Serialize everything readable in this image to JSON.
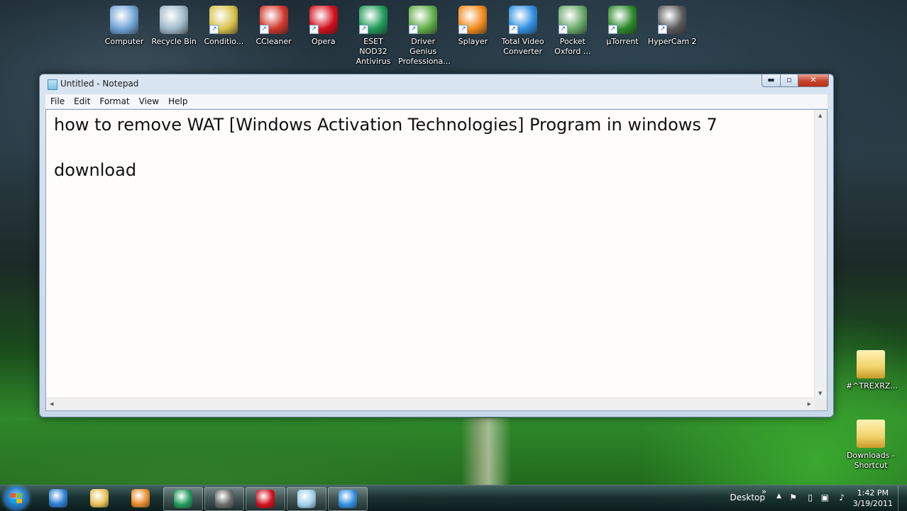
{
  "desktop_icons": [
    {
      "label": "Computer",
      "icon": "computer-icon",
      "color": "#6fa3d6"
    },
    {
      "label": "Recycle Bin",
      "icon": "recycle-bin-icon",
      "color": "#9fb8c9"
    },
    {
      "label": "Conditio...",
      "icon": "counter-strike-icon",
      "color": "#d8c24a"
    },
    {
      "label": "CCleaner",
      "icon": "ccleaner-icon",
      "color": "#d2362a"
    },
    {
      "label": "Opera",
      "icon": "opera-icon",
      "color": "#d40f1c"
    },
    {
      "label": "ESET NOD32 Antivirus",
      "icon": "eset-nod32-icon",
      "color": "#1f9a5a"
    },
    {
      "label": "Driver Genius Professiona...",
      "icon": "driver-genius-icon",
      "color": "#5fae46"
    },
    {
      "label": "Splayer",
      "icon": "splayer-icon",
      "color": "#f08a1c"
    },
    {
      "label": "Total Video Converter",
      "icon": "total-video-converter-icon",
      "color": "#2f8fe0"
    },
    {
      "label": "Pocket Oxford ...",
      "icon": "pocket-oxford-icon",
      "color": "#6aa86a"
    },
    {
      "label": "µTorrent",
      "icon": "utorrent-icon",
      "color": "#2b8a2b"
    },
    {
      "label": "HyperCam 2",
      "icon": "hypercam-icon",
      "color": "#585858"
    }
  ],
  "right_icons": [
    {
      "label": "#^TREXRZ...",
      "icon": "folder-icon",
      "color": "#f2d26a"
    },
    {
      "label": "Downloads - Shortcut",
      "icon": "downloads-folder-icon",
      "color": "#f2d26a"
    }
  ],
  "window": {
    "title": "Untitled - Notepad",
    "caption": {
      "minimize": "▬",
      "maximize": "▫",
      "close": "✕"
    },
    "menu": [
      "File",
      "Edit",
      "Format",
      "View",
      "Help"
    ],
    "text": "how to remove WAT [Windows Activation Technologies] Program in windows 7\n\ndownload"
  },
  "taskbar": {
    "pinned": [
      {
        "icon": "internet-explorer-icon",
        "color": "#2a7fd4",
        "running": false
      },
      {
        "icon": "file-explorer-icon",
        "color": "#e8c15a",
        "running": false
      },
      {
        "icon": "media-player-icon",
        "color": "#e88a2a",
        "running": false
      },
      {
        "icon": "eset-taskbar-icon",
        "color": "#1f9a5a",
        "running": true
      },
      {
        "icon": "hypercam-taskbar-icon",
        "color": "#6b6b6b",
        "running": true
      },
      {
        "icon": "opera-taskbar-icon",
        "color": "#d40f1c",
        "running": true
      },
      {
        "icon": "notepad-taskbar-icon",
        "color": "#9fd0ea",
        "running": true
      },
      {
        "icon": "total-video-converter-taskbar-icon",
        "color": "#2f8fe0",
        "running": true
      }
    ],
    "desktop_label": "Desktop",
    "chevron": "»",
    "tray_expand": "▲",
    "time": "1:42 PM",
    "date": "3/19/2011"
  }
}
